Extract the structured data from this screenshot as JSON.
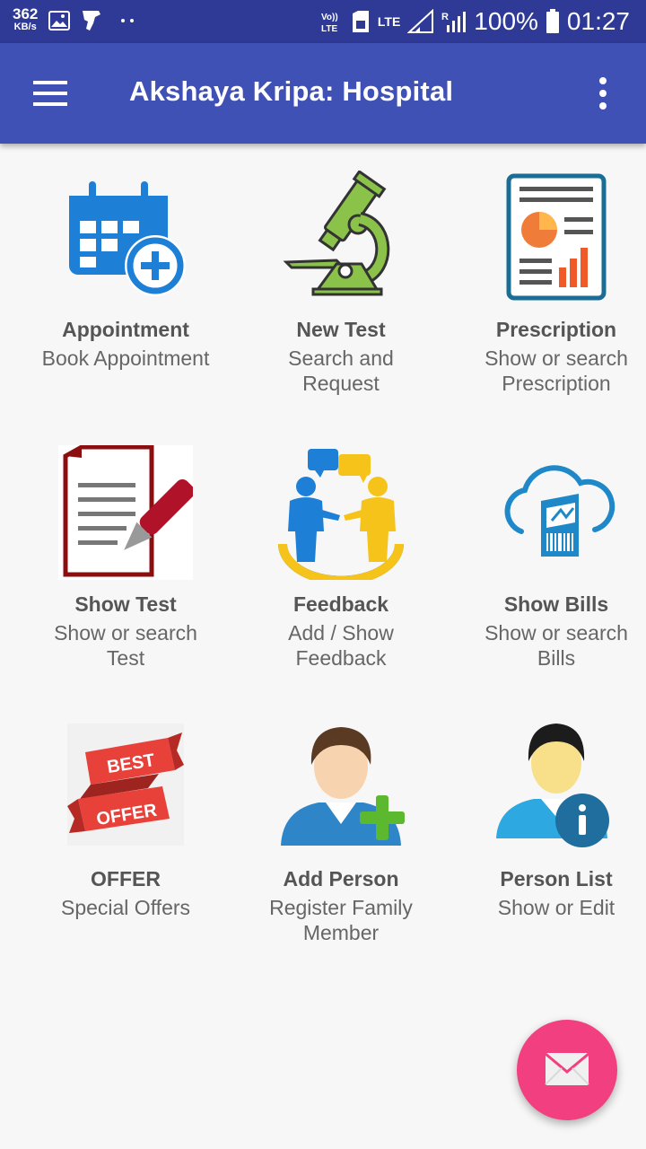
{
  "status_bar": {
    "speed_value": "362",
    "speed_unit": "KB/s",
    "network_label": "LTE",
    "battery_percent": "100%",
    "time": "01:27"
  },
  "app_bar": {
    "title": "Akshaya Kripa: Hospital"
  },
  "tiles": [
    {
      "name": "Appointment",
      "desc": "Book Appointment",
      "icon": "calendar-add-icon"
    },
    {
      "name": "New Test",
      "desc": "Search and Request",
      "icon": "microscope-icon"
    },
    {
      "name": "Prescription",
      "desc": "Show or search Prescription",
      "icon": "report-chart-icon"
    },
    {
      "name": "Show Test",
      "desc": "Show or search Test",
      "icon": "document-pen-icon"
    },
    {
      "name": "Feedback",
      "desc": "Add / Show Feedback",
      "icon": "people-chat-icon"
    },
    {
      "name": "Show Bills",
      "desc": "Show or search Bills",
      "icon": "cloud-bill-icon"
    },
    {
      "name": "OFFER",
      "desc": "Special Offers",
      "icon": "best-offer-ribbon-icon",
      "badge_line1": "BEST",
      "badge_line2": "OFFER"
    },
    {
      "name": "Add Person",
      "desc": "Register Family Member",
      "icon": "add-person-icon"
    },
    {
      "name": "Person List",
      "desc": "Show or Edit",
      "icon": "person-info-icon"
    }
  ],
  "fab": {
    "icon": "mail-icon"
  },
  "colors": {
    "status_bar": "#2f3a96",
    "app_bar": "#3f51b5",
    "fab": "#f23f7f",
    "background": "#f7f7f7"
  }
}
